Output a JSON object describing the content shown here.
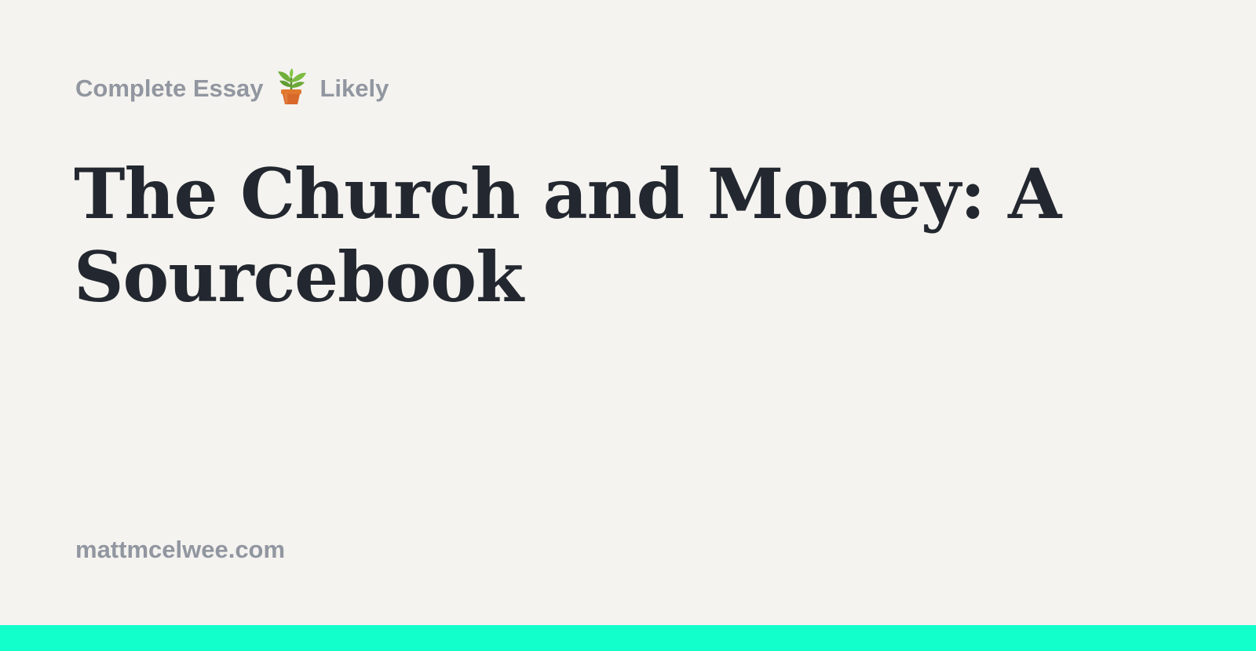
{
  "header": {
    "status": "Complete Essay",
    "status_icon": "potted-plant-icon",
    "confidence": "Likely"
  },
  "article": {
    "title": "The Church and Money: A Sourcebook"
  },
  "footer": {
    "site": "mattmcelwee.com"
  },
  "colors": {
    "background": "#f4f3ef",
    "title": "#23272f",
    "meta_text": "#9196a0",
    "accent": "#12ffcc"
  }
}
